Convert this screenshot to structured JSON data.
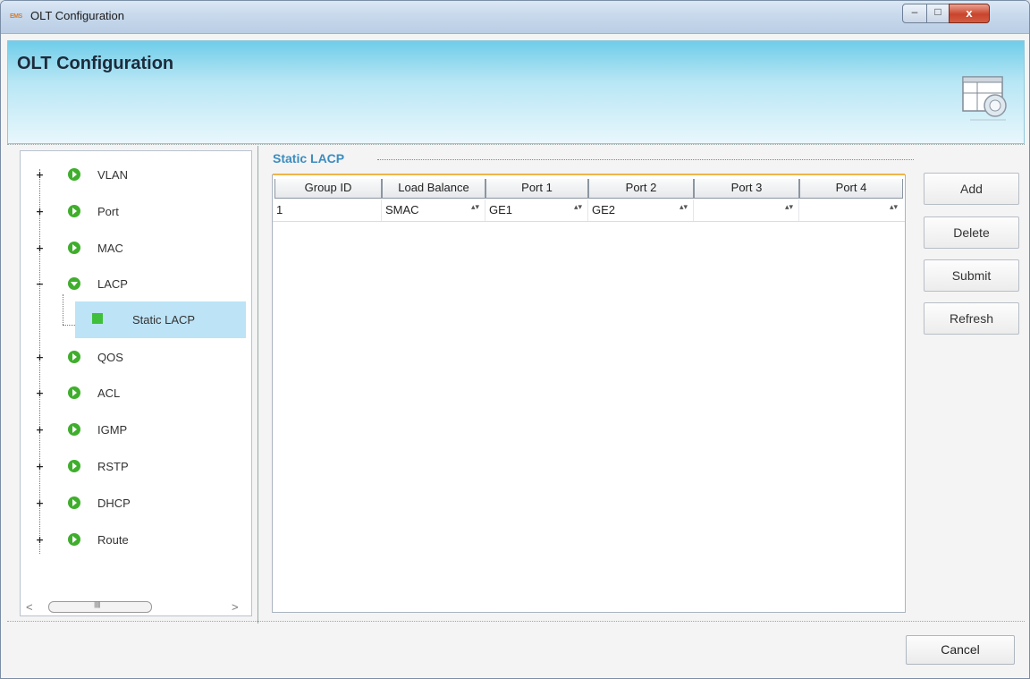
{
  "window": {
    "title": "OLT Configuration",
    "app_icon_text": "EMS",
    "controls": {
      "minimize": "–",
      "maximize": "□",
      "close": "x"
    }
  },
  "header": {
    "title": "OLT Configuration",
    "icon": "config-panel-icon"
  },
  "tree": {
    "items": [
      {
        "label": "VLAN",
        "expander": "+"
      },
      {
        "label": "Port",
        "expander": "+"
      },
      {
        "label": "MAC",
        "expander": "+"
      },
      {
        "label": "LACP",
        "expander": "−"
      },
      {
        "label": "QOS",
        "expander": "+"
      },
      {
        "label": "ACL",
        "expander": "+"
      },
      {
        "label": "IGMP",
        "expander": "+"
      },
      {
        "label": "RSTP",
        "expander": "+"
      },
      {
        "label": "DHCP",
        "expander": "+"
      },
      {
        "label": "Route",
        "expander": "+"
      }
    ],
    "selected_child": {
      "label": "Static LACP"
    },
    "scrollbar": {
      "left_arrow": "<",
      "right_arrow": ">",
      "grip": "||||||"
    }
  },
  "section": {
    "title": "Static LACP"
  },
  "table": {
    "columns": [
      "Group ID",
      "Load Balance",
      "Port 1",
      "Port 2",
      "Port 3",
      "Port 4"
    ],
    "rows": [
      [
        "1",
        "SMAC",
        "GE1",
        "GE2",
        "",
        ""
      ]
    ],
    "spinner_glyph": "▴▾"
  },
  "buttons": {
    "add": "Add",
    "delete": "Delete",
    "submit": "Submit",
    "refresh": "Refresh",
    "cancel": "Cancel"
  }
}
